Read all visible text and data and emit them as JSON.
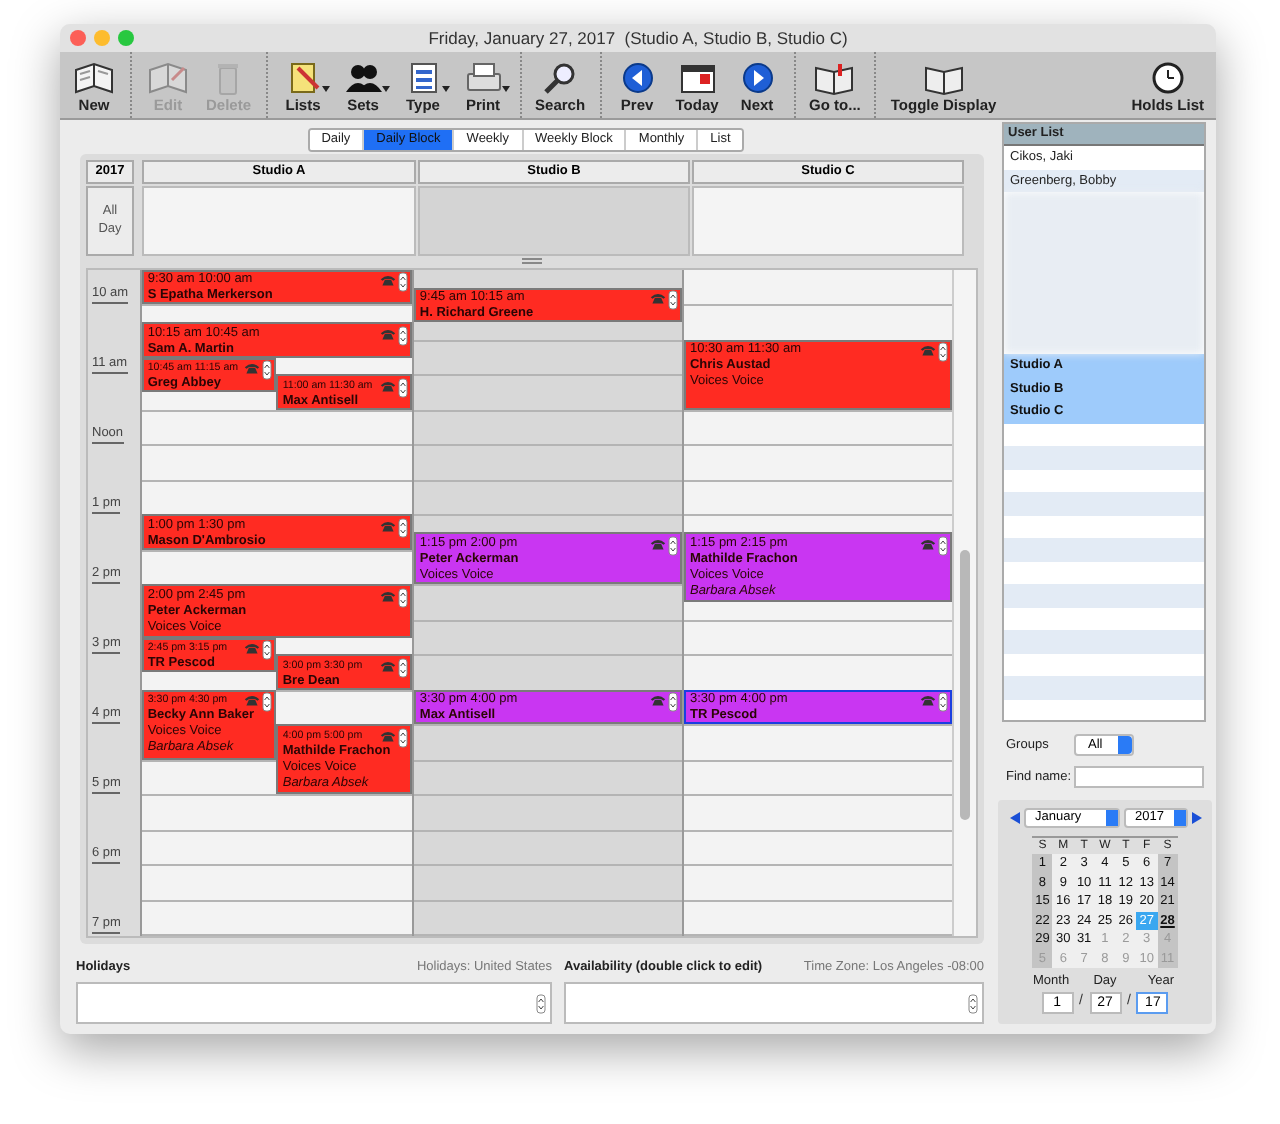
{
  "window": {
    "title": "Friday, January 27, 2017  (Studio A, Studio B, Studio C)"
  },
  "toolbar": [
    [
      {
        "label": "New",
        "disabled": false,
        "menu": false
      }
    ],
    [
      {
        "label": "Edit",
        "disabled": true,
        "menu": false
      },
      {
        "label": "Delete",
        "disabled": true,
        "menu": false
      }
    ],
    [
      {
        "label": "Lists",
        "disabled": false,
        "menu": true
      },
      {
        "label": "Sets",
        "disabled": false,
        "menu": true
      },
      {
        "label": "Type",
        "disabled": false,
        "menu": true
      },
      {
        "label": "Print",
        "disabled": false,
        "menu": true
      }
    ],
    [
      {
        "label": "Search",
        "disabled": false,
        "menu": false
      }
    ],
    [
      {
        "label": "Prev",
        "disabled": false,
        "menu": false
      },
      {
        "label": "Today",
        "disabled": false,
        "menu": false
      },
      {
        "label": "Next",
        "disabled": false,
        "menu": false
      }
    ],
    [
      {
        "label": "Go to...",
        "disabled": false,
        "menu": false
      }
    ],
    [
      {
        "label": "Toggle Display",
        "disabled": false,
        "menu": false
      }
    ],
    [
      {
        "label": "Holds List",
        "disabled": false,
        "menu": false
      }
    ]
  ],
  "view_tabs": [
    {
      "label": "Daily",
      "selected": false
    },
    {
      "label": "Daily Block",
      "selected": true
    },
    {
      "label": "Weekly",
      "selected": false
    },
    {
      "label": "Weekly Block",
      "selected": false
    },
    {
      "label": "Monthly",
      "selected": false
    },
    {
      "label": "List",
      "selected": false
    }
  ],
  "calendar": {
    "year": "2017",
    "all_day_label": "All Day",
    "hour_labels": [
      "10 am",
      "11 am",
      "Noon",
      "1 pm",
      "2 pm",
      "3 pm",
      "4 pm",
      "5 pm",
      "6 pm",
      "7 pm"
    ],
    "columns": [
      {
        "label": "Studio A",
        "shaded": false,
        "events": [
          {
            "time": "9:30 am 10:00 am",
            "name": "S Epatha Merkerson",
            "color": "#ff2b22",
            "selected": false
          },
          {
            "time": "10:15 am 10:45 am",
            "name": "Sam A. Martin",
            "color": "#ff2b22",
            "selected": false
          },
          {
            "time": "10:45 am 11:15 am",
            "name": "Greg Abbey",
            "color": "#ff2b22",
            "selected": false
          },
          {
            "time": "11:00 am 11:30 am",
            "name": "Max Antisell",
            "color": "#ff2b22",
            "selected": false
          },
          {
            "time": "1:00 pm 1:30 pm",
            "name": "Mason D'Ambrosio",
            "color": "#ff2b22",
            "selected": false
          },
          {
            "time": "2:00 pm 2:45 pm",
            "name": "Peter Ackerman",
            "lines": [
              "Voices Voice"
            ],
            "color": "#ff2b22",
            "selected": false
          },
          {
            "time": "2:45 pm 3:15 pm",
            "name": "TR Pescod",
            "color": "#ff2b22",
            "selected": false
          },
          {
            "time": "3:00 pm 3:30 pm",
            "name": "Bre Dean",
            "color": "#ff2b22",
            "selected": false
          },
          {
            "time": "3:30 pm 4:30 pm",
            "name": "Becky Ann Baker",
            "lines": [
              "Voices Voice"
            ],
            "note": "Barbara Absek",
            "color": "#ff2b22",
            "selected": false
          },
          {
            "time": "4:00 pm 5:00 pm",
            "name": "Mathilde Frachon",
            "lines": [
              "Voices Voice"
            ],
            "note": "Barbara Absek",
            "color": "#ff2b22",
            "selected": false
          }
        ]
      },
      {
        "label": "Studio B",
        "shaded": true,
        "events": [
          {
            "time": "9:45 am 10:15 am",
            "name": "H. Richard Greene",
            "color": "#ff2b22",
            "selected": false
          },
          {
            "time": "1:15 pm 2:00 pm",
            "name": "Peter Ackerman",
            "lines": [
              "Voices Voice"
            ],
            "color": "#c936f2",
            "selected": false
          },
          {
            "time": "3:30 pm 4:00 pm",
            "name": "Max Antisell",
            "color": "#c936f2",
            "selected": false
          }
        ]
      },
      {
        "label": "Studio C",
        "shaded": false,
        "events": [
          {
            "time": "10:30 am 11:30 am",
            "name": "Chris Austad",
            "lines": [
              "Voices Voice"
            ],
            "color": "#ff2b22",
            "selected": false
          },
          {
            "time": "1:15 pm 2:15 pm",
            "name": "Mathilde Frachon",
            "lines": [
              "Voices Voice"
            ],
            "note": "Barbara Absek",
            "color": "#c936f2",
            "selected": false
          },
          {
            "time": "3:30 pm 4:00 pm",
            "name": "TR Pescod",
            "color": "#c936f2",
            "selected": true
          }
        ]
      }
    ]
  },
  "holidays": {
    "label": "Holidays",
    "source": "Holidays: United States"
  },
  "availability": {
    "label": "Availability (double click to edit)",
    "time_zone": "Time Zone: Los Angeles -08:00"
  },
  "user_list": {
    "header": "User List",
    "items": [
      {
        "kind": "user",
        "label": "Cikos, Jaki",
        "selected": false
      },
      {
        "kind": "user",
        "label": "Greenberg, Bobby",
        "selected": false
      },
      {
        "kind": "blurred",
        "selected": false
      },
      {
        "kind": "user",
        "label": "Studio A",
        "selected": true
      },
      {
        "kind": "user",
        "label": "Studio B",
        "selected": true
      },
      {
        "kind": "user",
        "label": "Studio C",
        "selected": true
      }
    ]
  },
  "groups": {
    "label": "Groups",
    "value": "All"
  },
  "find_name": {
    "label": "Find name:"
  },
  "mini_calendar": {
    "month": "January",
    "year": "2017",
    "weekdays": [
      "S",
      "M",
      "T",
      "W",
      "T",
      "F",
      "S"
    ],
    "weeks": [
      [
        {
          "label": "1",
          "outside": false,
          "selected": false,
          "today": false
        },
        {
          "label": "2",
          "outside": false,
          "selected": false,
          "today": false
        },
        {
          "label": "3",
          "outside": false,
          "selected": false,
          "today": false
        },
        {
          "label": "4",
          "outside": false,
          "selected": false,
          "today": false
        },
        {
          "label": "5",
          "outside": false,
          "selected": false,
          "today": false
        },
        {
          "label": "6",
          "outside": false,
          "selected": false,
          "today": false
        },
        {
          "label": "7",
          "outside": false,
          "selected": false,
          "today": false
        }
      ],
      [
        {
          "label": "8",
          "outside": false,
          "selected": false,
          "today": false
        },
        {
          "label": "9",
          "outside": false,
          "selected": false,
          "today": false
        },
        {
          "label": "10",
          "outside": false,
          "selected": false,
          "today": false
        },
        {
          "label": "11",
          "outside": false,
          "selected": false,
          "today": false
        },
        {
          "label": "12",
          "outside": false,
          "selected": false,
          "today": false
        },
        {
          "label": "13",
          "outside": false,
          "selected": false,
          "today": false
        },
        {
          "label": "14",
          "outside": false,
          "selected": false,
          "today": false
        }
      ],
      [
        {
          "label": "15",
          "outside": false,
          "selected": false,
          "today": false
        },
        {
          "label": "16",
          "outside": false,
          "selected": false,
          "today": false
        },
        {
          "label": "17",
          "outside": false,
          "selected": false,
          "today": false
        },
        {
          "label": "18",
          "outside": false,
          "selected": false,
          "today": false
        },
        {
          "label": "19",
          "outside": false,
          "selected": false,
          "today": false
        },
        {
          "label": "20",
          "outside": false,
          "selected": false,
          "today": false
        },
        {
          "label": "21",
          "outside": false,
          "selected": false,
          "today": false
        }
      ],
      [
        {
          "label": "22",
          "outside": false,
          "selected": false,
          "today": false
        },
        {
          "label": "23",
          "outside": false,
          "selected": false,
          "today": false
        },
        {
          "label": "24",
          "outside": false,
          "selected": false,
          "today": false
        },
        {
          "label": "25",
          "outside": false,
          "selected": false,
          "today": false
        },
        {
          "label": "26",
          "outside": false,
          "selected": false,
          "today": false
        },
        {
          "label": "27",
          "outside": false,
          "selected": true,
          "today": false
        },
        {
          "label": "28",
          "outside": false,
          "selected": false,
          "today": true
        }
      ],
      [
        {
          "label": "29",
          "outside": false,
          "selected": false,
          "today": false
        },
        {
          "label": "30",
          "outside": false,
          "selected": false,
          "today": false
        },
        {
          "label": "31",
          "outside": false,
          "selected": false,
          "today": false
        },
        {
          "label": "1",
          "outside": true,
          "selected": false,
          "today": false
        },
        {
          "label": "2",
          "outside": true,
          "selected": false,
          "today": false
        },
        {
          "label": "3",
          "outside": true,
          "selected": false,
          "today": false
        },
        {
          "label": "4",
          "outside": true,
          "selected": false,
          "today": false
        }
      ],
      [
        {
          "label": "5",
          "outside": true,
          "selected": false,
          "today": false
        },
        {
          "label": "6",
          "outside": true,
          "selected": false,
          "today": false
        },
        {
          "label": "7",
          "outside": true,
          "selected": false,
          "today": false
        },
        {
          "label": "8",
          "outside": true,
          "selected": false,
          "today": false
        },
        {
          "label": "9",
          "outside": true,
          "selected": false,
          "today": false
        },
        {
          "label": "10",
          "outside": true,
          "selected": false,
          "today": false
        },
        {
          "label": "11",
          "outside": true,
          "selected": false,
          "today": false
        }
      ]
    ]
  },
  "date_fields": {
    "month_label": "Month",
    "day_label": "Day",
    "year_label": "Year",
    "month": "1",
    "day": "27",
    "year": "17",
    "separator": "/"
  }
}
